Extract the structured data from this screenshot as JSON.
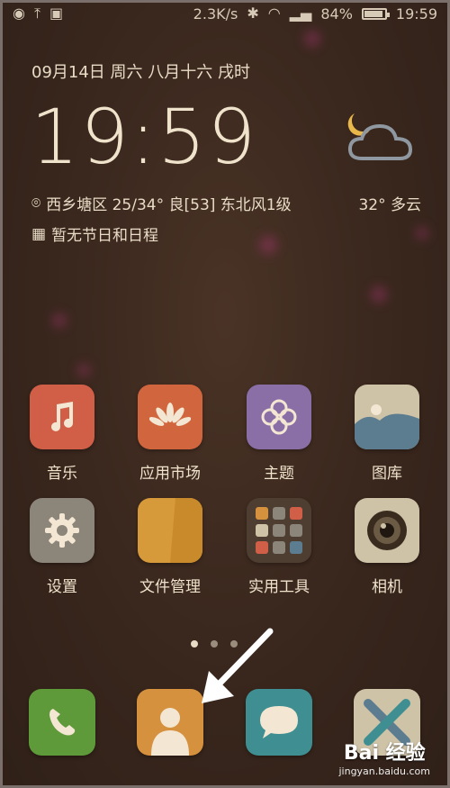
{
  "status_bar": {
    "speed": "2.3K/s",
    "battery": "84%",
    "battery_level": 0.84,
    "time": "19:59"
  },
  "clock_widget": {
    "date": "09月14日  周六  八月十六  戌时",
    "time": "19:59",
    "location_weather": "西乡塘区 25/34° 良[53] 东北风1级",
    "temperature": "32° 多云",
    "schedule": "暂无节日和日程"
  },
  "apps": [
    {
      "label": "音乐",
      "color": "#d15f48",
      "icon": "music-note-icon"
    },
    {
      "label": "应用市场",
      "color": "#d1663e",
      "icon": "huawei-petals-icon"
    },
    {
      "label": "主题",
      "color": "#8a6fa7",
      "icon": "flower-icon"
    },
    {
      "label": "图库",
      "color": "#cfc3a7",
      "icon": "mountain-icon"
    },
    {
      "label": "设置",
      "color": "#8c857a",
      "icon": "gear-icon"
    },
    {
      "label": "文件管理",
      "color": "#d69a3a",
      "icon": "folder-icon"
    },
    {
      "label": "实用工具",
      "color": "#4e3e32",
      "icon": "folder-grid-icon"
    },
    {
      "label": "相机",
      "color": "#cfc3a7",
      "icon": "camera-lens-icon"
    }
  ],
  "dock": [
    {
      "name": "phone",
      "color": "#5f9a3a",
      "icon": "phone-icon"
    },
    {
      "name": "contacts",
      "color": "#d6913f",
      "icon": "contact-person-icon"
    },
    {
      "name": "messages",
      "color": "#3f8f92",
      "icon": "chat-bubble-icon"
    },
    {
      "name": "x-app",
      "color": "#cfc3a7",
      "icon": "x-cross-icon"
    }
  ],
  "page_indicator": {
    "count": 3,
    "active": 0
  },
  "watermark": {
    "text": "Bai 经验",
    "url": "jingyan.baidu.com"
  }
}
